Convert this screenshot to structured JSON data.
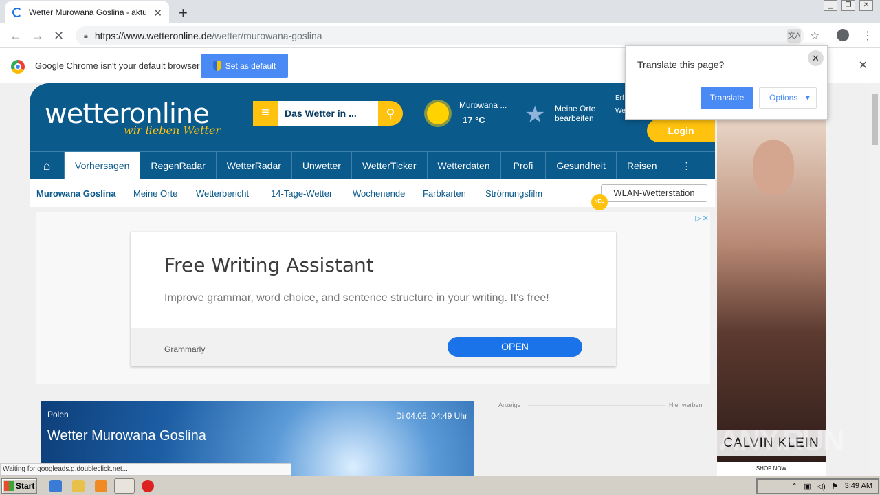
{
  "browser": {
    "tab_title": "Wetter Murowana Goslina - aktuelle",
    "new_tab": "+",
    "url_host": "https://www.wetteronline.de",
    "url_path": "/wetter/murowana-goslina"
  },
  "infobar": {
    "message": "Google Chrome isn't your default browser",
    "set_default": "Set as default"
  },
  "translate_popup": {
    "title": "Translate this page?",
    "translate": "Translate",
    "options": "Options"
  },
  "site": {
    "logo_main": "wetter",
    "logo_accent": "online",
    "slogan": "wir lieben Wetter",
    "search_placeholder": "Das Wetter in ...",
    "weather_city": "Murowana ...",
    "weather_temp": "17 °C",
    "meine_orte_1": "Meine Orte",
    "meine_orte_2": "bearbeiten",
    "erf_1": "Erf",
    "erf_2": "Wet",
    "login": "Login",
    "nav": [
      "Vorhersagen",
      "RegenRadar",
      "WetterRadar",
      "Unwetter",
      "WetterTicker",
      "Wetterdaten",
      "Profi",
      "Gesundheit",
      "Reisen"
    ],
    "subnav": [
      "Murowana Goslina",
      "Meine Orte",
      "Wetterbericht",
      "14-Tage-Wetter",
      "Wochenende",
      "Farbkarten",
      "Strömungsfilm"
    ],
    "wlan": "WLAN-Wetterstation",
    "neu": "NEU"
  },
  "ad": {
    "title": "Free Writing Assistant",
    "description": "Improve grammar, word choice, and sentence structure in your writing. It's free!",
    "brand": "Grammarly",
    "cta": "OPEN"
  },
  "hero": {
    "country": "Polen",
    "datetime": "Di 04.06. 04:49 Uhr",
    "title": "Wetter Murowana Goslina"
  },
  "side": {
    "anzeige": "Anzeige",
    "hier_werben": "Hier werben",
    "ad_logo": "CALVIN KLEIN",
    "ad_shop": "SHOP NOW",
    "watermark": "ANY.RUN"
  },
  "status_text": "Waiting for googleads.g.doubleclick.net...",
  "taskbar": {
    "start": "Start",
    "clock": "3:49 AM"
  }
}
